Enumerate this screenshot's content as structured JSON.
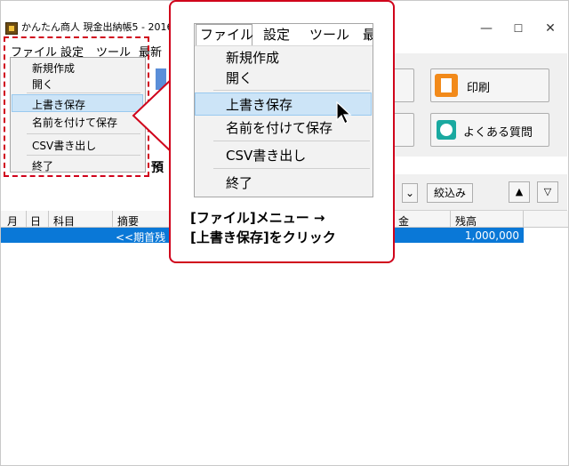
{
  "window": {
    "title": "かんたん商人 現金出納帳5 - 2016株式会",
    "controls": {
      "minimize": "—",
      "maximize": "☐",
      "close": "✕"
    }
  },
  "menubar": {
    "file": "ファイル",
    "settings": "設定",
    "tools": "ツール",
    "recent": "最新"
  },
  "file_menu": {
    "items": [
      "新規作成",
      "開く",
      "上書き保存",
      "名前を付けて保存",
      "CSV書き出し",
      "終了"
    ],
    "highlighted": "上書き保存"
  },
  "toolbar": {
    "print_label": "印刷",
    "faq_label": "よくある質問",
    "filter_label": "絞込み",
    "up": "▲",
    "down": "▽",
    "partial_tab": "預"
  },
  "grid": {
    "headers": [
      "月",
      "日",
      "科目",
      "摘要",
      "金",
      "残高"
    ],
    "rows": [
      {
        "summary": "<<期首残",
        "balance": "1,000,000"
      }
    ]
  },
  "callout": {
    "zoom_menubar": {
      "file": "ファイル",
      "settings": "設定",
      "tools": "ツール",
      "recent": "最"
    },
    "caption_line1": "[ファイル]メニュー →",
    "caption_line2": "[上書き保存]をクリック"
  },
  "colors": {
    "accent_red": "#d0021b",
    "selection_blue": "#0a78d7",
    "menu_highlight": "#cce4f7"
  }
}
